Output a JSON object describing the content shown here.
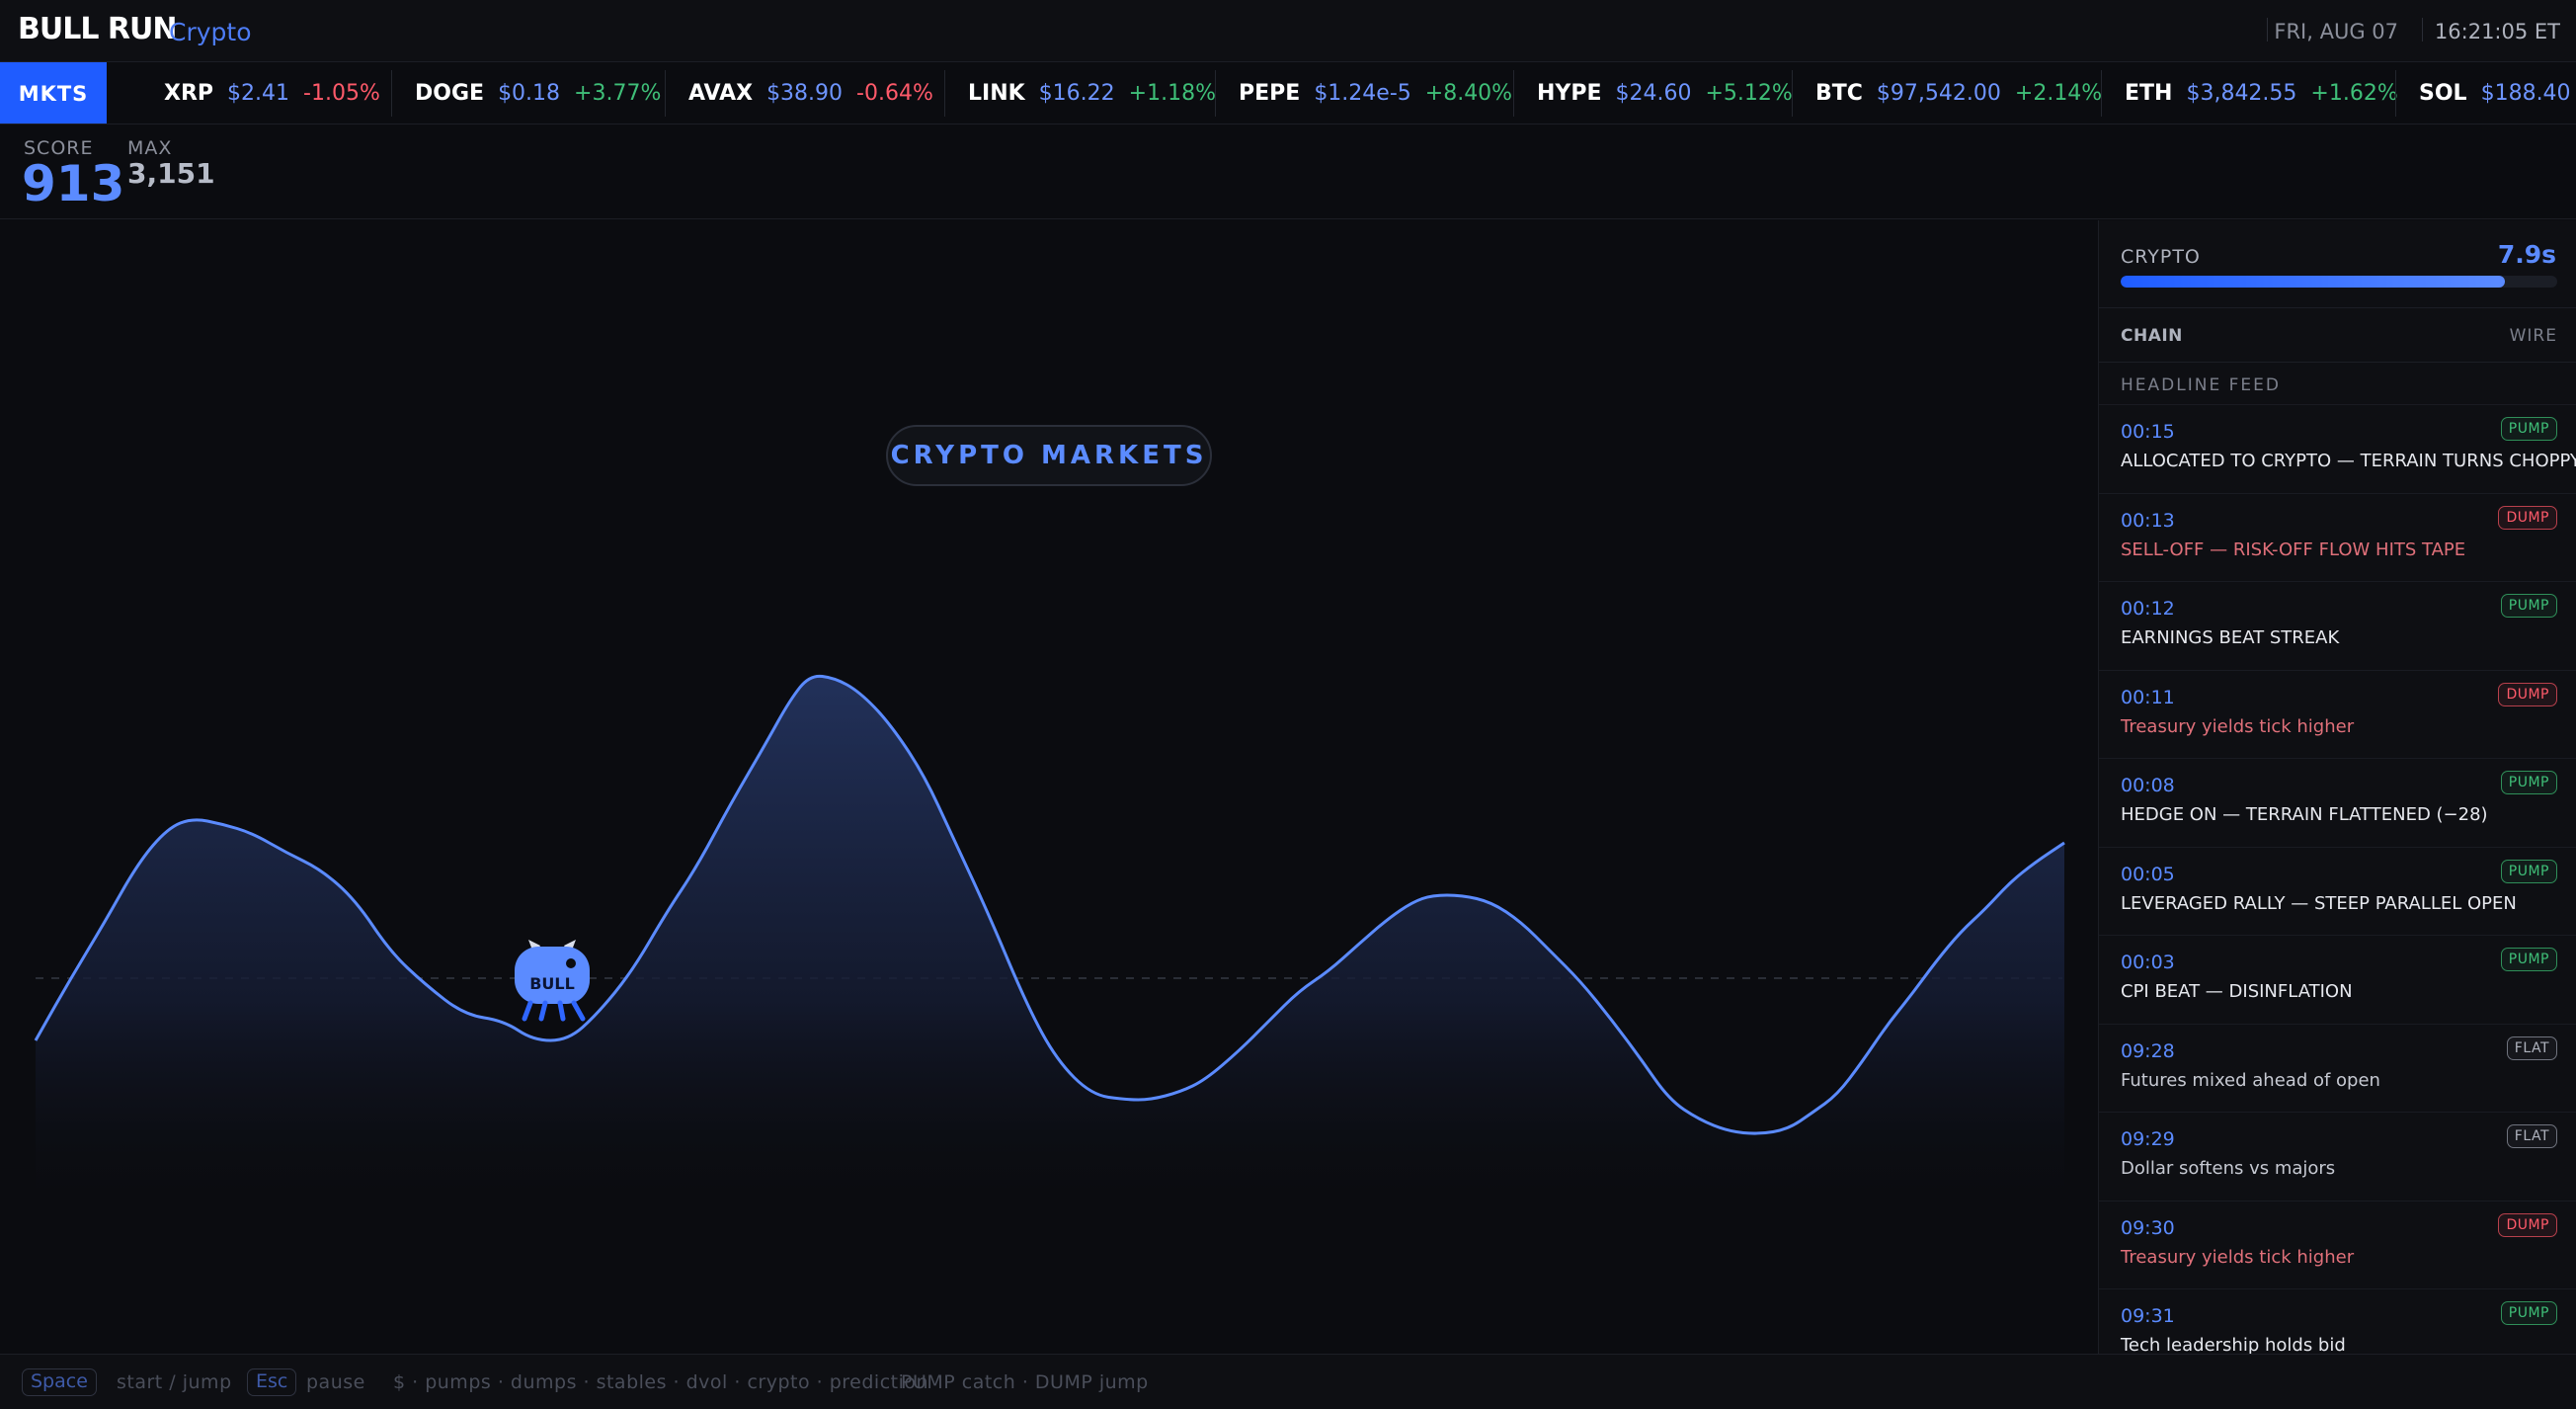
{
  "header": {
    "brand": "BULL RUN",
    "mode": "Crypto",
    "date": "FRI, AUG 07",
    "time": "16:21:05 ET"
  },
  "ticker": {
    "label": "MKTS",
    "items": [
      {
        "symbol": "XRP",
        "price": "$2.41",
        "change": "-1.05%",
        "dir": "down"
      },
      {
        "symbol": "DOGE",
        "price": "$0.18",
        "change": "+3.77%",
        "dir": "up"
      },
      {
        "symbol": "AVAX",
        "price": "$38.90",
        "change": "-0.64%",
        "dir": "down"
      },
      {
        "symbol": "LINK",
        "price": "$16.22",
        "change": "+1.18%",
        "dir": "up"
      },
      {
        "symbol": "PEPE",
        "price": "$1.24e-5",
        "change": "+8.40%",
        "dir": "up"
      },
      {
        "symbol": "HYPE",
        "price": "$24.60",
        "change": "+5.12%",
        "dir": "up"
      },
      {
        "symbol": "BTC",
        "price": "$97,542.00",
        "change": "+2.14%",
        "dir": "up"
      },
      {
        "symbol": "ETH",
        "price": "$3,842.55",
        "change": "+1.62%",
        "dir": "up"
      },
      {
        "symbol": "SOL",
        "price": "$188.40",
        "change": "",
        "dir": "up"
      }
    ]
  },
  "score": {
    "score_label": "SCORE",
    "score_value": "913",
    "max_label": "MAX",
    "max_value": "3,151"
  },
  "game": {
    "banner": "CRYPTO MARKETS",
    "player_label": "BULL",
    "terrain_color": "#5b8bff"
  },
  "sidebar": {
    "category": "CRYPTO",
    "timer": "7.9s",
    "progress": 0.88,
    "tab_chain": "CHAIN",
    "tab_wire": "WIRE",
    "feed_label": "HEADLINE FEED",
    "feed": [
      {
        "time": "00:15",
        "text": "ALLOCATED TO CRYPTO — TERRAIN TURNS CHOPPY",
        "tag": "PUMP",
        "kind": "pump"
      },
      {
        "time": "00:13",
        "text": "SELL-OFF — RISK-OFF FLOW HITS TAPE",
        "tag": "DUMP",
        "kind": "dump"
      },
      {
        "time": "00:12",
        "text": "EARNINGS BEAT STREAK",
        "tag": "PUMP",
        "kind": "pump"
      },
      {
        "time": "00:11",
        "text": "Treasury yields tick higher",
        "tag": "DUMP",
        "kind": "dump"
      },
      {
        "time": "00:08",
        "text": "HEDGE ON — TERRAIN FLATTENED (−28)",
        "tag": "PUMP",
        "kind": "pump"
      },
      {
        "time": "00:05",
        "text": "LEVERAGED RALLY — STEEP PARALLEL OPEN",
        "tag": "PUMP",
        "kind": "pump"
      },
      {
        "time": "00:03",
        "text": "CPI BEAT — DISINFLATION",
        "tag": "PUMP",
        "kind": "pump"
      },
      {
        "time": "09:28",
        "text": "Futures mixed ahead of open",
        "tag": "FLAT",
        "kind": "flat"
      },
      {
        "time": "09:29",
        "text": "Dollar softens vs majors",
        "tag": "FLAT",
        "kind": "flat"
      },
      {
        "time": "09:30",
        "text": "Treasury yields tick higher",
        "tag": "DUMP",
        "kind": "dump"
      },
      {
        "time": "09:31",
        "text": "Tech leadership holds bid",
        "tag": "PUMP",
        "kind": "pump"
      }
    ]
  },
  "footer": {
    "key_space": "Space",
    "space_action": "start / jump",
    "key_esc": "Esc",
    "esc_action": "pause",
    "legend": "$ · pumps · dumps · stables · dvol · crypto · prediction",
    "hint": "PUMP catch · DUMP jump"
  }
}
